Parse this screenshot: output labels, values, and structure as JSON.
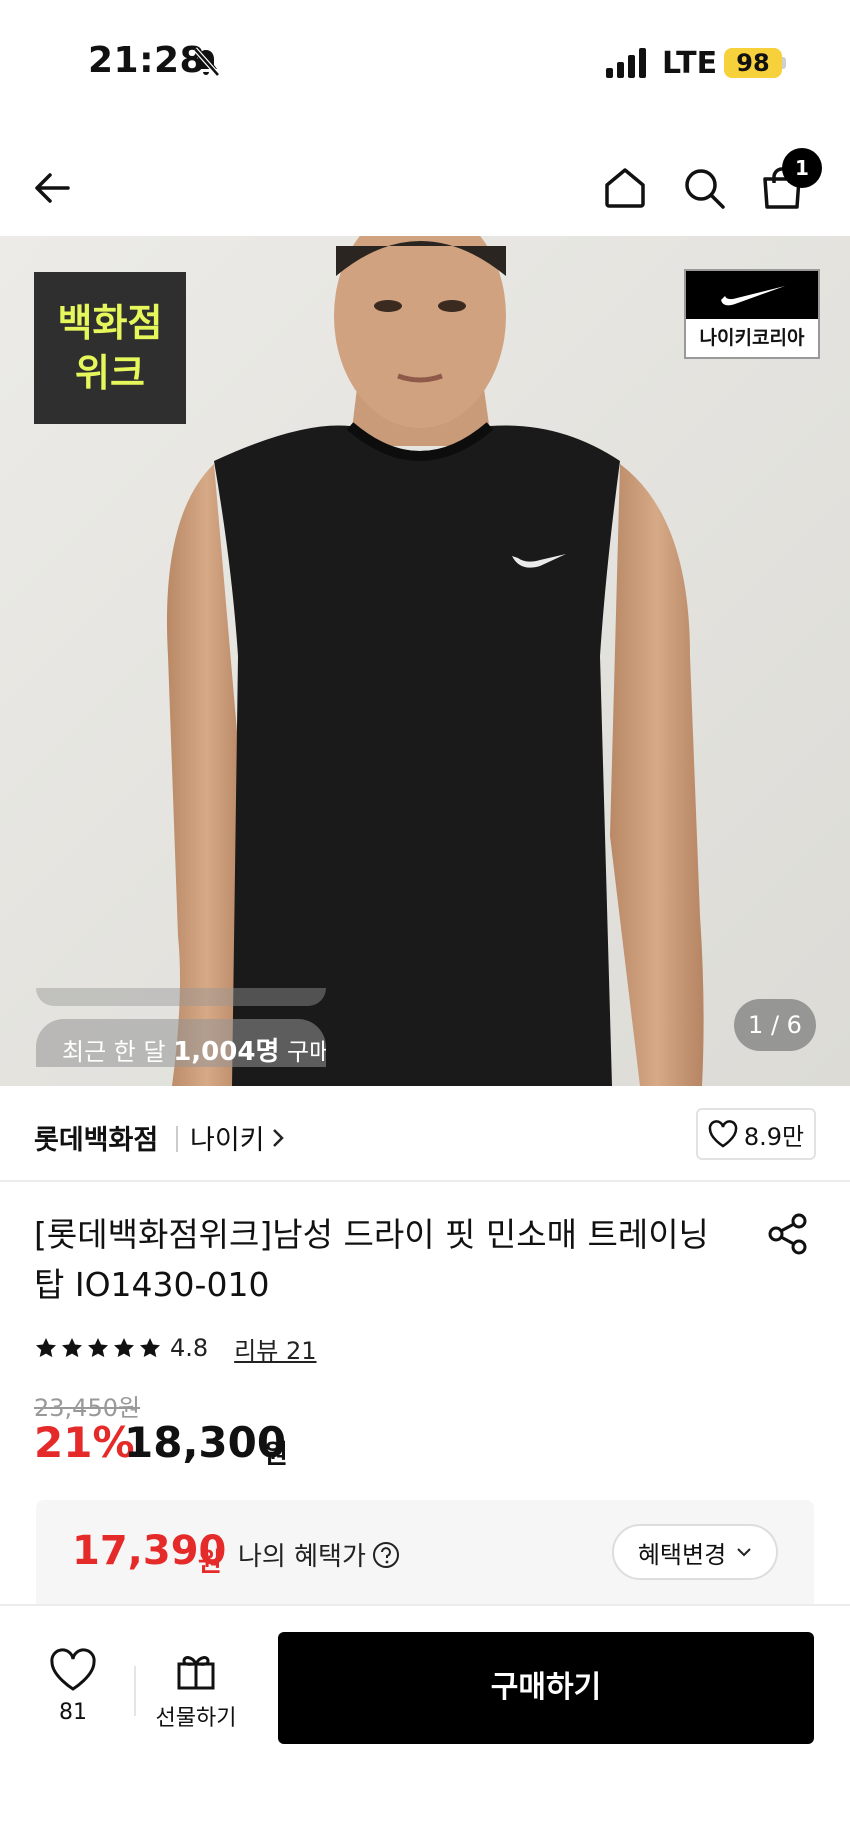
{
  "status_bar": {
    "time": "21:28",
    "network": "LTE",
    "battery": "98"
  },
  "nav": {
    "back_icon": "arrow-left-icon",
    "home_icon": "home-icon",
    "search_icon": "search-icon",
    "cart_icon": "shopping-bag-icon",
    "cart_count": "1"
  },
  "hero": {
    "promo_line1": "백화점",
    "promo_line2": "위크",
    "brand_badge_text": "나이키코리아",
    "ticker_prefix": "최근 한 달 ",
    "ticker_count": "1,004명",
    "ticker_suffix": " 구매",
    "page_indicator": "1 / 6"
  },
  "seller": {
    "store_name": "롯데백화점",
    "brand_name": "나이키",
    "like_count": "8.9만"
  },
  "product": {
    "title": "[롯데백화점위크]남성 드라이 핏 민소매 트레이닝 탑 IO1430-010",
    "rating": "4.8",
    "review_label": "리뷰 21",
    "star_count": 5,
    "original_price": "23,450원",
    "discount_rate": "21%",
    "sale_price": "18,300",
    "sale_price_unit": "원"
  },
  "benefit": {
    "price": "17,390",
    "unit": "원",
    "label": "나의 혜택가",
    "change_button": "혜택변경"
  },
  "bottom_bar": {
    "wish_count": "81",
    "gift_label": "선물하기",
    "buy_label": "구매하기"
  },
  "colors": {
    "accent_red": "#e52a2a",
    "promo_text": "#e5f75a",
    "battery": "#f6d13b"
  }
}
